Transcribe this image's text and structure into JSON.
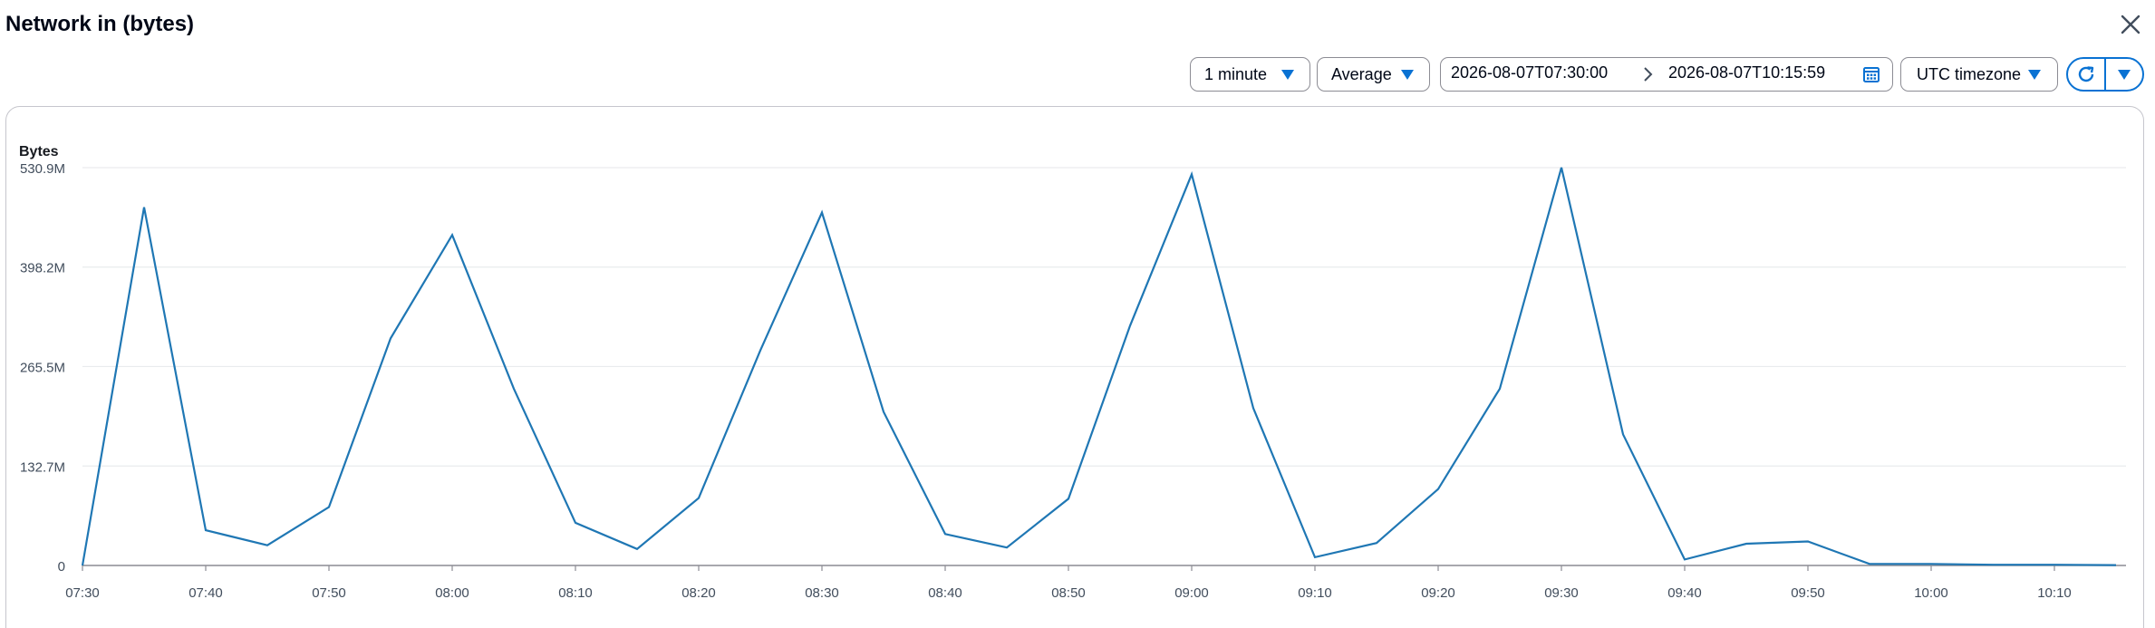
{
  "header": {
    "title": "Network in (bytes)"
  },
  "toolbar": {
    "period": "1 minute",
    "statistic": "Average",
    "start_time": "2026-08-07T07:30:00",
    "end_time": "2026-08-07T10:15:59",
    "timezone": "UTC timezone"
  },
  "icons": {
    "close": "close-icon",
    "caret": "caret-down-icon",
    "calendar": "calendar-icon",
    "arrow": "chevron-right-icon",
    "refresh": "refresh-icon"
  },
  "colors": {
    "series": "#1f77b4",
    "accent": "#0972d3",
    "grid": "#e9ebed",
    "text": "#16191f"
  },
  "chart_data": {
    "type": "line",
    "ylabel": "Bytes",
    "ylim": [
      0,
      530.9
    ],
    "y_unit": "M",
    "y_ticks": [
      "0",
      "132.7M",
      "265.5M",
      "398.2M",
      "530.9M"
    ],
    "y_tick_values": [
      0,
      132.7,
      265.5,
      398.2,
      530.9
    ],
    "x_ticks": [
      "07:30",
      "07:40",
      "07:50",
      "08:00",
      "08:10",
      "08:20",
      "08:30",
      "08:40",
      "08:50",
      "09:00",
      "09:10",
      "09:20",
      "09:30",
      "09:40",
      "09:50",
      "10:00",
      "10:10"
    ],
    "x_range": [
      "07:30",
      "10:16"
    ],
    "grid": true,
    "series": [
      {
        "color": "#1f77b4",
        "x": [
          "07:30",
          "07:35",
          "07:40",
          "07:45",
          "07:50",
          "07:55",
          "08:00",
          "08:05",
          "08:10",
          "08:15",
          "08:20",
          "08:25",
          "08:30",
          "08:35",
          "08:40",
          "08:45",
          "08:50",
          "08:55",
          "09:00",
          "09:05",
          "09:10",
          "09:15",
          "09:20",
          "09:25",
          "09:30",
          "09:35",
          "09:40",
          "09:45",
          "09:50",
          "09:55",
          "10:00",
          "10:05",
          "10:10",
          "10:15"
        ],
        "values": [
          0,
          478,
          47,
          27,
          78,
          303,
          441,
          236,
          57,
          22,
          90,
          287,
          471,
          205,
          42,
          24,
          89,
          320,
          522,
          210,
          11,
          30,
          102,
          236,
          531,
          175,
          8,
          29,
          32,
          2,
          2,
          1,
          1,
          0.5
        ]
      }
    ]
  }
}
